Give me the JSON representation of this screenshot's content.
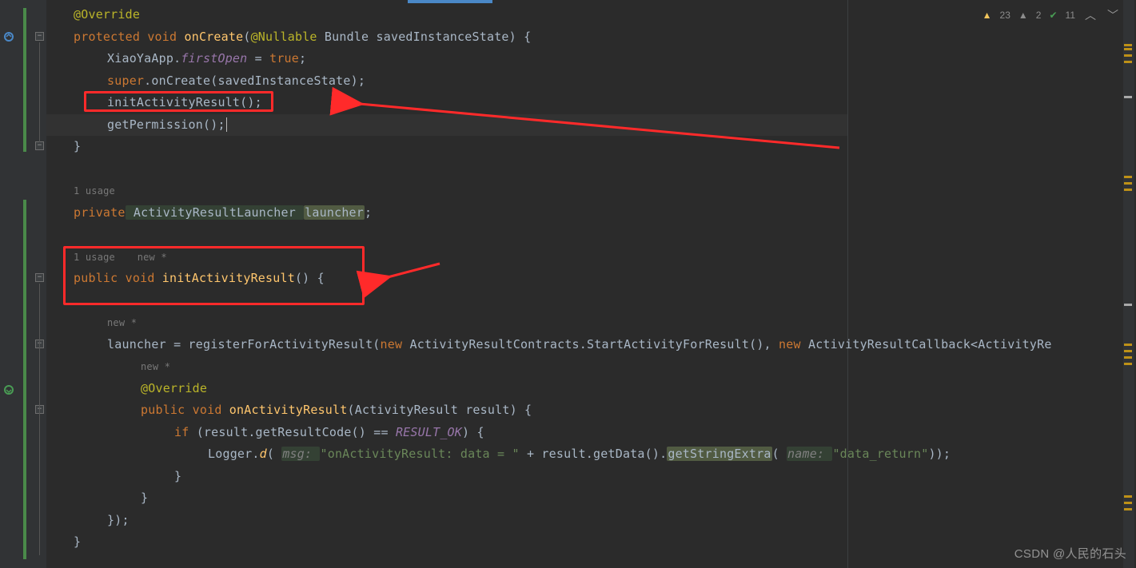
{
  "inspection": {
    "warn_strong_count": "23",
    "warn_weak_count": "2",
    "ok_count": "11"
  },
  "code": {
    "l1_ann": "@Override",
    "l2_kw1": "protected",
    "l2_kw2": "void",
    "l2_fn": "onCreate",
    "l2_open": "(",
    "l2_ann": "@Nullable",
    "l2_t1": " Bundle savedInstanceState) {",
    "l3_cls": "XiaoYaApp.",
    "l3_fld": "firstOpen",
    "l3_eq": " = ",
    "l3_true": "true",
    "l3_semi": ";",
    "l4_super": "super",
    "l4_call": ".onCreate(savedInstanceState);",
    "l5_call": "initActivityResult();",
    "l6_call": "getPermission();",
    "l7_brace": "}",
    "l8_hint": "1 usage",
    "l9_kw": "private",
    "l9_type": " ActivityResultLauncher ",
    "l9_var": "launcher",
    "l9_semi": ";",
    "l10_hint1": "1 usage",
    "l10_hint2": "new *",
    "l11_kw1": "public",
    "l11_kw2": "void",
    "l11_fn": "initActivityResult",
    "l11_rest": "() {",
    "l12_hint": "new *",
    "l13_a": "launcher = registerForActivityResult(",
    "l13_new": "new",
    "l13_b": " ActivityResultContracts.StartActivityForResult(), ",
    "l13_new2": "new",
    "l13_c": " ActivityResultCallback<ActivityRe",
    "l14_hint": "new *",
    "l15_ann": "@Override",
    "l16_kw1": "public",
    "l16_kw2": "void",
    "l16_fn": "onActivityResult",
    "l16_rest": "(ActivityResult result) {",
    "l17_if": "if",
    "l17_a": " (result.getResultCode() == ",
    "l17_const": "RESULT_OK",
    "l17_b": ") {",
    "l18_a": "Logger.",
    "l18_d": "d",
    "l18_p1": "( ",
    "l18_hint": "msg: ",
    "l18_str": "\"onActivityResult: data = \"",
    "l18_b": " + result.getData().",
    "l18_m": "getStringExtra",
    "l18_p2": "( ",
    "l18_hint2": "name: ",
    "l18_str2": "\"data_return\"",
    "l18_c": "));",
    "l19_brace": "}",
    "l20_brace": "}",
    "l21_brace": "});",
    "l22_brace": "}"
  },
  "watermark": "CSDN @人民的石头"
}
